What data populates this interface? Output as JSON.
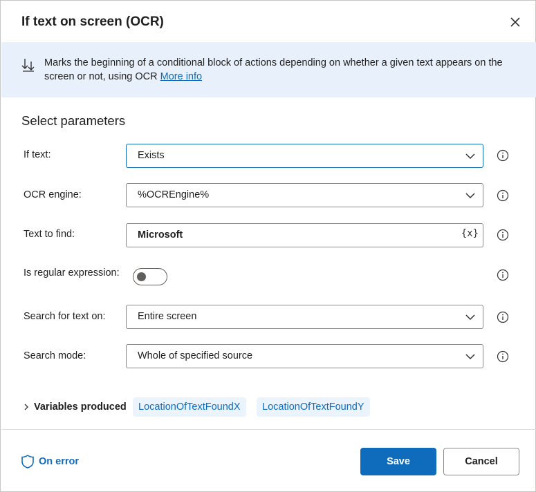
{
  "dialog": {
    "title": "If text on screen (OCR)",
    "description": "Marks the beginning of a conditional block of actions depending on whether a given text appears on the screen or not, using OCR",
    "more_info_label": "More info",
    "section_title": "Select parameters"
  },
  "params": {
    "if_text": {
      "label": "If text:",
      "value": "Exists"
    },
    "ocr_engine": {
      "label": "OCR engine:",
      "value": "%OCREngine%"
    },
    "text_to_find": {
      "label": "Text to find:",
      "value": "Microsoft",
      "var_icon": "{x}"
    },
    "is_regex": {
      "label": "Is regular expression:",
      "enabled": false
    },
    "search_for_text_on": {
      "label": "Search for text on:",
      "value": "Entire screen"
    },
    "search_mode": {
      "label": "Search mode:",
      "value": "Whole of specified source"
    }
  },
  "variables": {
    "label": "Variables produced",
    "items": [
      "LocationOfTextFoundX",
      "LocationOfTextFoundY"
    ]
  },
  "footer": {
    "on_error_label": "On error",
    "save_label": "Save",
    "cancel_label": "Cancel"
  },
  "colors": {
    "accent": "#0f6cbd",
    "banner_bg": "#e8f1fb",
    "chip_bg": "#ebf3fc"
  },
  "icons": [
    "close-icon",
    "conditional-block-icon",
    "chevron-down-icon",
    "info-icon",
    "variable-icon",
    "chevron-right-icon",
    "shield-icon"
  ]
}
